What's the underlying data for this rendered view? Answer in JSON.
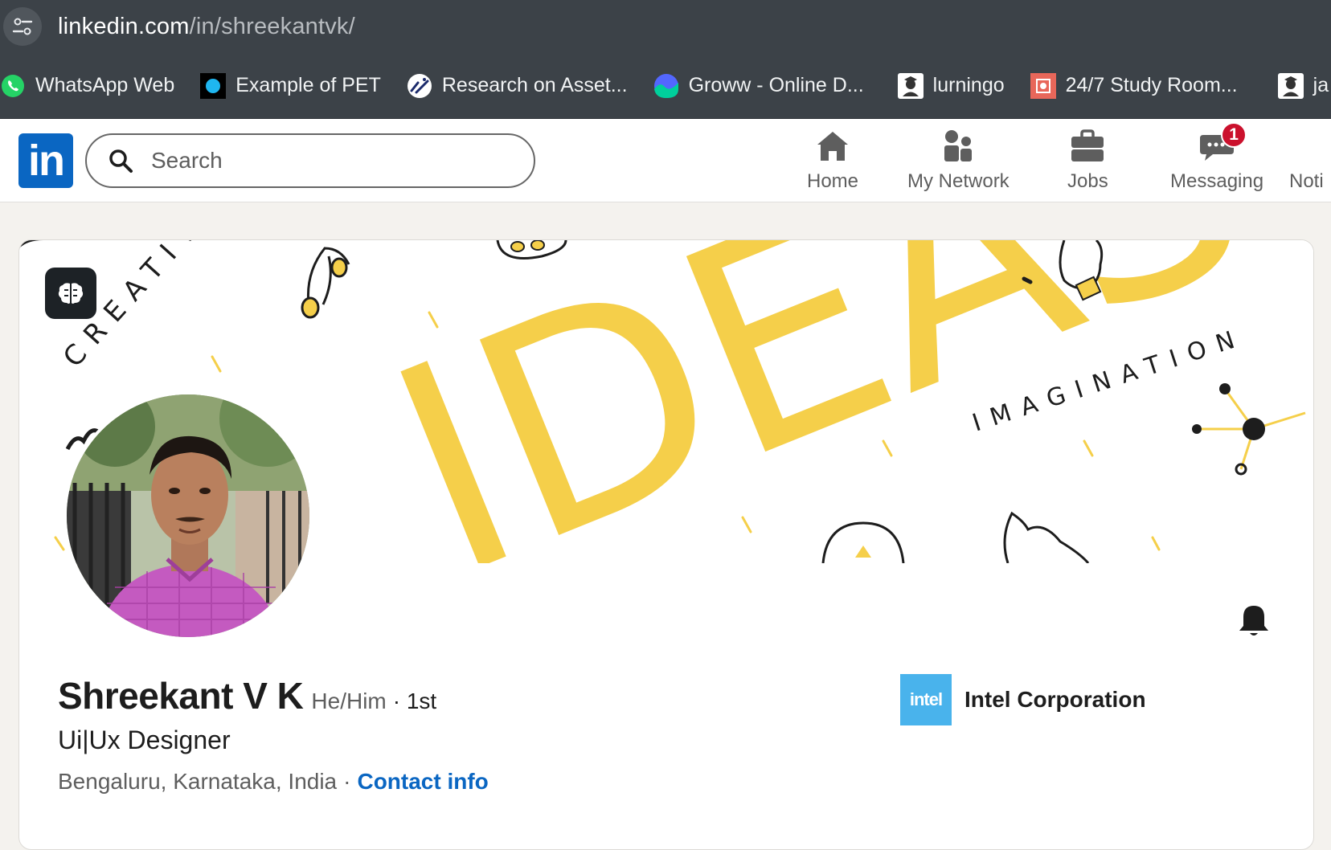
{
  "browser": {
    "url_host": "linkedin.com",
    "url_path": "/in/shreekantvk/",
    "bookmarks": [
      {
        "label": "WhatsApp Web"
      },
      {
        "label": "Example of PET"
      },
      {
        "label": "Research on Asset..."
      },
      {
        "label": "Groww - Online D..."
      },
      {
        "label": "lurningo"
      },
      {
        "label": "24/7 Study Room..."
      },
      {
        "label": "ja"
      }
    ]
  },
  "nav": {
    "logo": "in",
    "search_placeholder": "Search",
    "items": [
      {
        "label": "Home"
      },
      {
        "label": "My Network"
      },
      {
        "label": "Jobs"
      },
      {
        "label": "Messaging",
        "badge": "1"
      },
      {
        "label": "Noti"
      }
    ]
  },
  "banner": {
    "word_main": "IDEAS",
    "word_creative": "CREATIVE",
    "word_imagination": "IMAGINATION"
  },
  "profile": {
    "name": "Shreekant V K",
    "pronouns": "He/Him",
    "degree": "· 1st",
    "headline": "Ui|Ux Designer",
    "location": "Bengaluru, Karnataka, India",
    "separator": "·",
    "contact_label": "Contact info",
    "company_logo_text": "intel",
    "company_name": "Intel Corporation"
  },
  "colors": {
    "linkedin_blue": "#0a66c2",
    "banner_yellow": "#f5cf4a",
    "badge_red": "#cb112d",
    "intel_blue": "#49b3ec"
  }
}
